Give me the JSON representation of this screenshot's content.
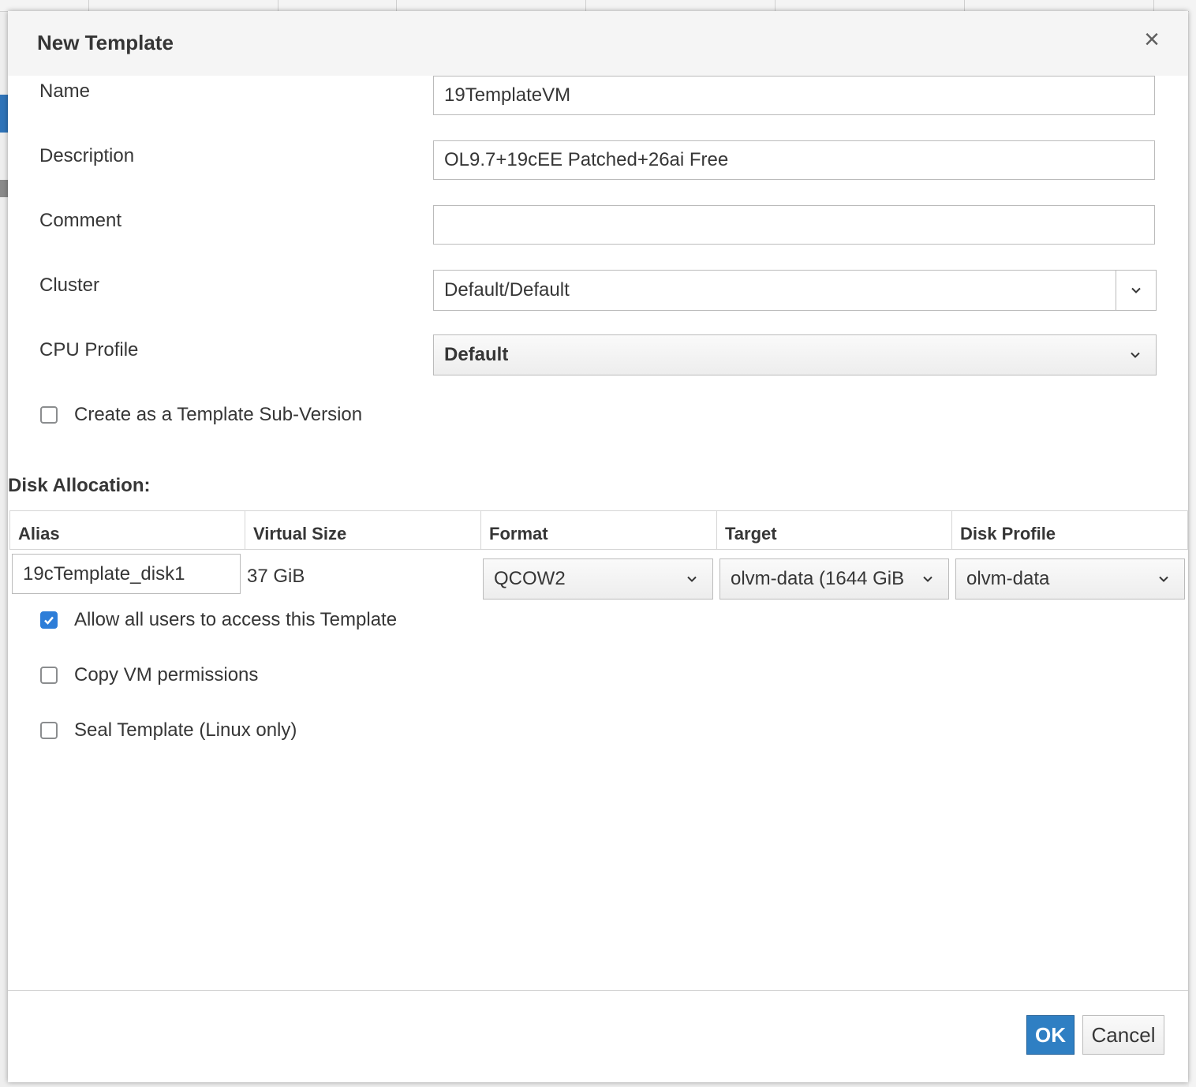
{
  "dialog": {
    "title": "New Template",
    "close_icon": "×"
  },
  "fields": {
    "name_label": "Name",
    "name_value": "19TemplateVM",
    "description_label": "Description",
    "description_value": "OL9.7+19cEE Patched+26ai Free",
    "comment_label": "Comment",
    "comment_value": "",
    "cluster_label": "Cluster",
    "cluster_value": "Default/Default",
    "cpu_profile_label": "CPU Profile",
    "cpu_profile_value": "Default"
  },
  "sub_version": {
    "label": "Create as a Template Sub-Version",
    "checked": false
  },
  "disk_allocation": {
    "title": "Disk Allocation:",
    "columns": [
      "Alias",
      "Virtual Size",
      "Format",
      "Target",
      "Disk Profile"
    ],
    "rows": [
      {
        "alias": "19cTemplate_disk1",
        "virtual_size": "37 GiB",
        "format": "QCOW2",
        "target": "olvm-data (1644 GiB",
        "disk_profile": "olvm-data"
      }
    ]
  },
  "options": {
    "allow_all_users": {
      "label": "Allow all users to access this Template",
      "checked": true
    },
    "copy_vm_permissions": {
      "label": "Copy VM permissions",
      "checked": false
    },
    "seal_template": {
      "label": "Seal Template (Linux only)",
      "checked": false
    }
  },
  "footer": {
    "ok_label": "OK",
    "cancel_label": "Cancel"
  },
  "colors": {
    "primary": "#2f7fc3",
    "checkbox_checked": "#2d7dd8",
    "header_bg": "#f5f5f5"
  }
}
